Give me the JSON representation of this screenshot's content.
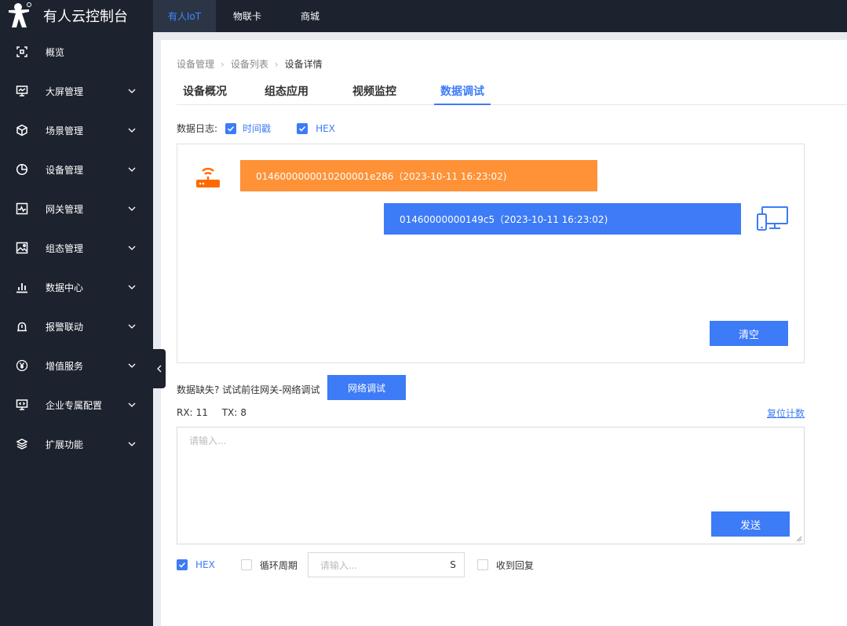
{
  "brand": {
    "title": "有人云控制台"
  },
  "topnav": [
    {
      "label": "有人IoT",
      "active": true
    },
    {
      "label": "物联卡",
      "active": false
    },
    {
      "label": "商城",
      "active": false
    }
  ],
  "sidebar": {
    "items": [
      {
        "label": "概览",
        "icon": "overview-icon"
      },
      {
        "label": "大屏管理",
        "icon": "monitor-icon"
      },
      {
        "label": "场景管理",
        "icon": "cube-icon"
      },
      {
        "label": "设备管理",
        "icon": "pie-chart-icon"
      },
      {
        "label": "网关管理",
        "icon": "pulse-icon"
      },
      {
        "label": "组态管理",
        "icon": "image-icon"
      },
      {
        "label": "数据中心",
        "icon": "bar-chart-icon"
      },
      {
        "label": "报警联动",
        "icon": "alarm-icon"
      },
      {
        "label": "增值服务",
        "icon": "yen-icon"
      },
      {
        "label": "企业专属配置",
        "icon": "code-monitor-icon"
      },
      {
        "label": "扩展功能",
        "icon": "layers-icon"
      }
    ]
  },
  "breadcrumb": {
    "items": [
      "设备管理",
      "设备列表",
      "设备详情"
    ]
  },
  "tabs": [
    {
      "label": "设备概况",
      "active": false
    },
    {
      "label": "组态应用",
      "active": false
    },
    {
      "label": "视频监控",
      "active": false
    },
    {
      "label": "数据调试",
      "active": true
    }
  ],
  "log_options": {
    "label": "数据日志:",
    "timestamp_label": "时间戳",
    "timestamp_checked": true,
    "hex_label": "HEX",
    "hex_checked": true
  },
  "messages": {
    "received": "0146000000010200001e286（2023-10-11 16:23:02)",
    "sent": "01460000000149c5（2023-10-11 16:23:02)"
  },
  "clear_button": "清空",
  "hint_text": "数据缺失? 试试前往网关-网络调试",
  "netdebug_button": "网络调试",
  "counters": {
    "rx_label": "RX:",
    "rx_value": "11",
    "tx_label": "TX:",
    "tx_value": "8"
  },
  "reset_link": "复位计数",
  "send_input": {
    "placeholder": "请输入...",
    "value": ""
  },
  "send_button": "发送",
  "bottom_options": {
    "hex_label": "HEX",
    "hex_checked": true,
    "cycle_label": "循环周期",
    "cycle_checked": false,
    "period_placeholder": "请输入...",
    "period_unit": "S",
    "reply_label": "收到回复",
    "reply_checked": false
  },
  "colors": {
    "sidebar_bg": "#1c222e",
    "accent": "#3d7bf7",
    "received_msg": "#ff9136",
    "sent_msg": "#3d7bf7"
  }
}
